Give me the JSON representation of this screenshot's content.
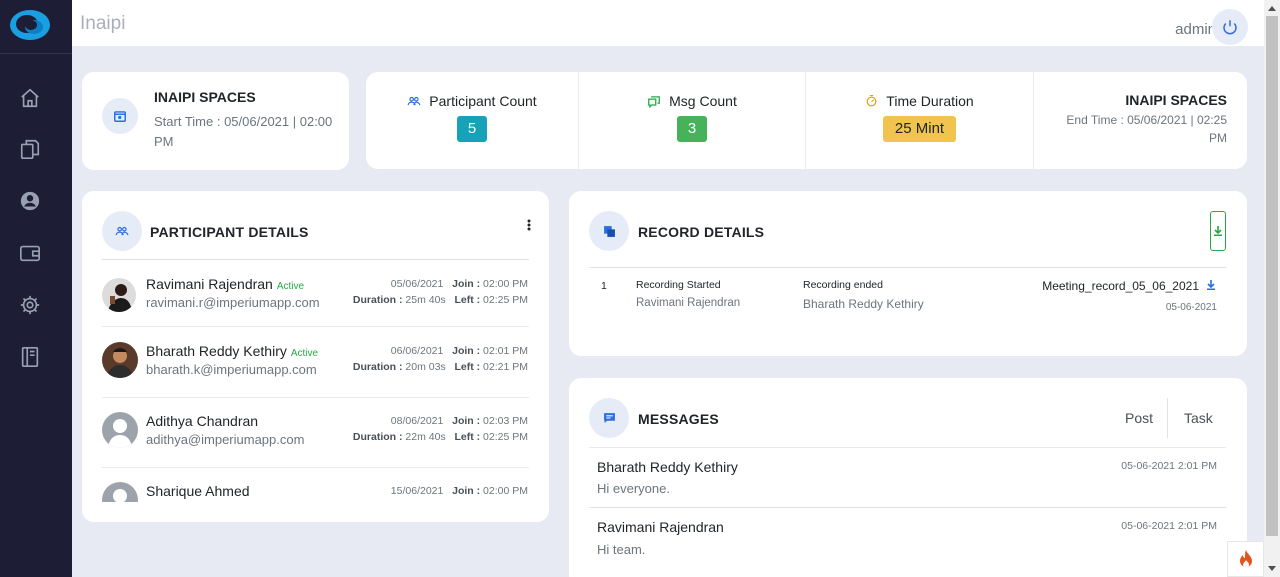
{
  "app": {
    "title": "Inaipi",
    "user": "admin"
  },
  "sidebar": {
    "items": [
      "home-icon",
      "files-icon",
      "user-icon",
      "wallet-icon",
      "settings-icon",
      "notebook-icon"
    ]
  },
  "space_start": {
    "title": "INAIPI SPACES",
    "start": "Start Time : 05/06/2021 | 02:00 PM"
  },
  "stats": {
    "participants": {
      "label": "Participant Count",
      "value": "5",
      "color": "#17a2b8"
    },
    "messages": {
      "label": "Msg Count",
      "value": "3",
      "color": "#28a745"
    },
    "duration": {
      "label": "Time Duration",
      "value": "25 Mint",
      "color": "#f0c44e"
    }
  },
  "space_end": {
    "title": "INAIPI SPACES",
    "end": "End Time : 05/06/2021 | 02:25 PM"
  },
  "participants": {
    "title": "PARTICIPANT DETAILS",
    "join_label": "Join :",
    "left_label": "Left :",
    "duration_label": "Duration :",
    "items": [
      {
        "name": "Ravimani Rajendran",
        "status": "Active",
        "email": "ravimani.r@imperiumapp.com",
        "date": "05/06/2021",
        "join": "02:00 PM",
        "duration": "25m 40s",
        "left": "02:25 PM"
      },
      {
        "name": "Bharath Reddy Kethiry",
        "status": "Active",
        "email": "bharath.k@imperiumapp.com",
        "date": "06/06/2021",
        "join": "02:01 PM",
        "duration": "20m 03s",
        "left": "02:21 PM"
      },
      {
        "name": "Adithya Chandran",
        "status": "",
        "email": "adithya@imperiumapp.com",
        "date": "08/06/2021",
        "join": "02:03 PM",
        "duration": "22m 40s",
        "left": "02:25 PM"
      },
      {
        "name": "Sharique Ahmed",
        "status": "",
        "email": "",
        "date": "15/06/2021",
        "join": "02:00 PM",
        "duration": "",
        "left": ""
      }
    ]
  },
  "records": {
    "title": "RECORD DETAILS",
    "items": [
      {
        "index": "1",
        "started_label": "Recording Started",
        "started_by": "Ravimani Rajendran",
        "ended_label": "Recording ended",
        "ended_by": "Bharath Reddy Kethiry",
        "file": "Meeting_record_05_06_2021",
        "date": "05-06-2021"
      }
    ]
  },
  "messages": {
    "title": "MESSAGES",
    "tabs": [
      "Post",
      "Task"
    ],
    "items": [
      {
        "name": "Bharath Reddy Kethiry",
        "text": "Hi everyone.",
        "time": "05-06-2021 2:01 PM"
      },
      {
        "name": "Ravimani Rajendran",
        "text": "Hi team.",
        "time": "05-06-2021 2:01 PM"
      }
    ]
  }
}
